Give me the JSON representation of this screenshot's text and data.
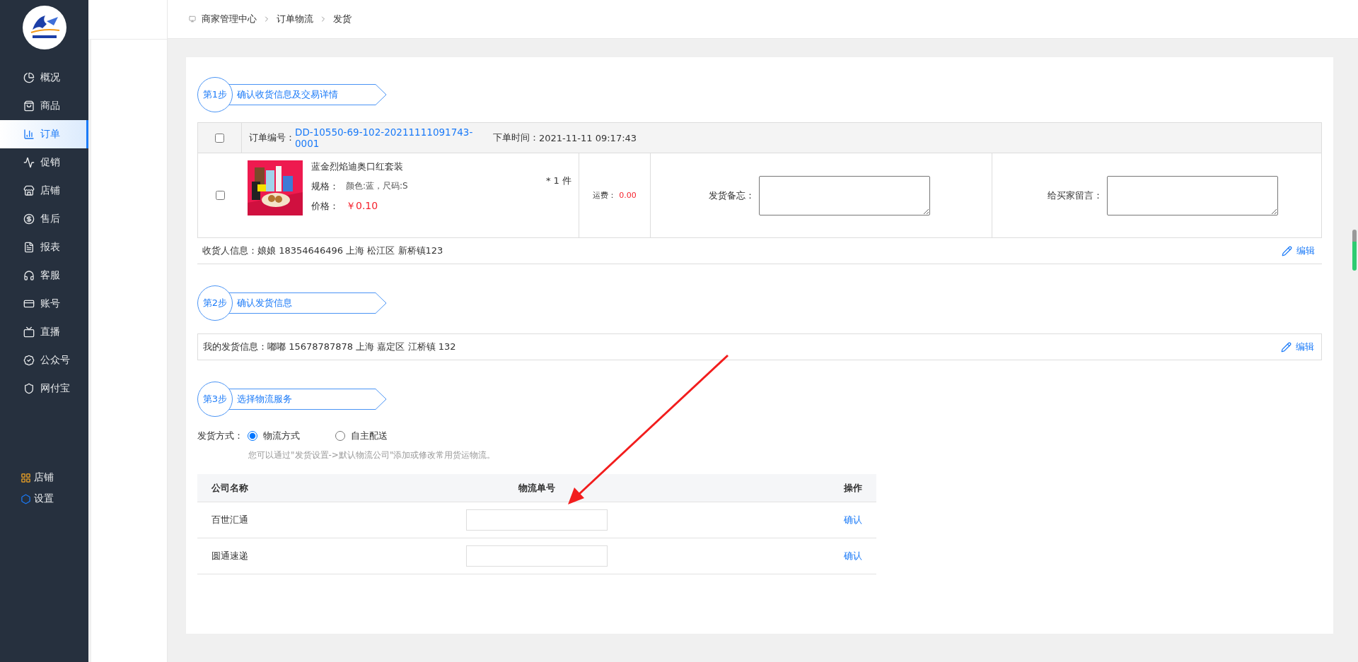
{
  "sidebar": {
    "items": [
      {
        "label": "概况",
        "selected": false
      },
      {
        "label": "商品",
        "selected": false
      },
      {
        "label": "订单",
        "selected": true
      },
      {
        "label": "促销",
        "selected": false
      },
      {
        "label": "店铺",
        "selected": false
      },
      {
        "label": "售后",
        "selected": false
      },
      {
        "label": "报表",
        "selected": false
      },
      {
        "label": "客服",
        "selected": false
      },
      {
        "label": "账号",
        "selected": false
      },
      {
        "label": "直播",
        "selected": false
      },
      {
        "label": "公众号",
        "selected": false
      },
      {
        "label": "网付宝",
        "selected": false
      }
    ],
    "bottom_items": [
      {
        "label": "店铺"
      },
      {
        "label": "设置"
      }
    ]
  },
  "breadcrumb": [
    "商家管理中心",
    "订单物流",
    "发货"
  ],
  "steps": [
    {
      "badge": "第1步",
      "title": "确认收货信息及交易详情"
    },
    {
      "badge": "第2步",
      "title": "确认发货信息"
    },
    {
      "badge": "第3步",
      "title": "选择物流服务"
    }
  ],
  "order": {
    "checked": false,
    "number_label": "订单编号：",
    "number": "DD-10550-69-102-20211111091743-0001",
    "time_label": "下单时间：",
    "time": "2021-11-11 09:17:43",
    "item": {
      "checked": false,
      "name": "蓝金烈焰迪奥口红套装",
      "spec_label": "规格：",
      "spec": "颜色:蓝，尺码:S",
      "price_label": "价格：",
      "price": "￥0.10",
      "quantity": "* 1 件",
      "freight_label": "运费：",
      "freight": "0.00",
      "note_label": "发货备忘：",
      "message_label": "给买家留言："
    },
    "receiver": "收货人信息：娘娘 18354646496  上海 松江区 新桥镇123",
    "edit": "编辑"
  },
  "sender": {
    "text": "我的发货信息：嘟嘟 15678787878 上海 嘉定区 江桥镇 132",
    "edit": "编辑"
  },
  "shipping": {
    "label": "发货方式：",
    "options": [
      {
        "label": "物流方式",
        "selected": true
      },
      {
        "label": "自主配送",
        "selected": false
      }
    ],
    "hint": "您可以通过\"发货设置->默认物流公司\"添加或修改常用货运物流。"
  },
  "logistics": {
    "columns": [
      "公司名称",
      "物流单号",
      "操作"
    ],
    "rows": [
      {
        "company": "百世汇通",
        "action": "确认"
      },
      {
        "company": "圆通速递",
        "action": "确认"
      }
    ]
  }
}
